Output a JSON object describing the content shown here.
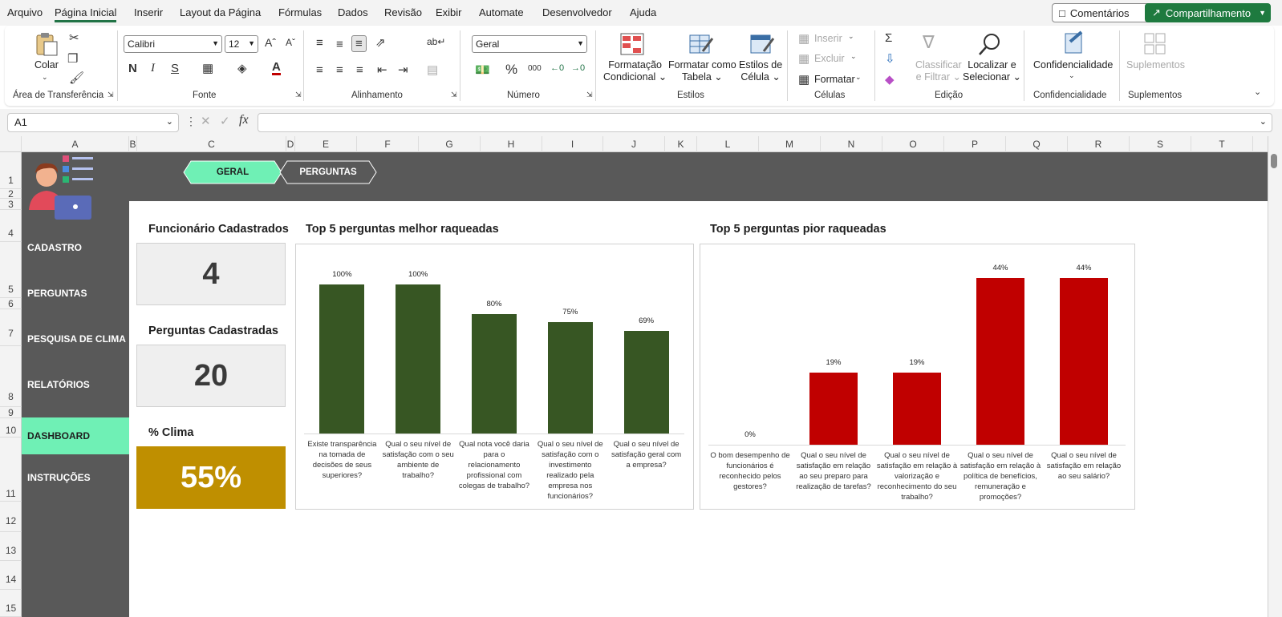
{
  "menu": {
    "items": [
      "Arquivo",
      "Página Inicial",
      "Inserir",
      "Layout da Página",
      "Fórmulas",
      "Dados",
      "Revisão",
      "Exibir",
      "Automate",
      "Desenvolvedor",
      "Ajuda"
    ],
    "active": "Página Inicial",
    "comments": "Comentários",
    "share": "Compartilhamento"
  },
  "ribbon": {
    "clipboard": {
      "paste": "Colar",
      "label": "Área de Transferência"
    },
    "font": {
      "name": "Calibri",
      "size": "12",
      "label": "Fonte"
    },
    "alignment": {
      "label": "Alinhamento"
    },
    "number": {
      "format": "Geral",
      "label": "Número"
    },
    "styles": {
      "conditional": [
        "Formatação",
        "Condicional"
      ],
      "table": [
        "Formatar como",
        "Tabela"
      ],
      "cell": [
        "Estilos de",
        "Célula"
      ],
      "label": "Estilos"
    },
    "cells": {
      "insert": "Inserir",
      "delete": "Excluir",
      "format": "Formatar",
      "label": "Células"
    },
    "editing": {
      "sort": [
        "Classificar",
        "e Filtrar"
      ],
      "find": [
        "Localizar e",
        "Selecionar"
      ],
      "label": "Edição"
    },
    "sensitivity": {
      "button": "Confidencialidade",
      "label": "Confidencialidade"
    },
    "addins": {
      "button": "Suplementos",
      "label": "Suplementos"
    }
  },
  "formula_bar": {
    "cell": "A1",
    "fx": "fx",
    "value": ""
  },
  "columns": [
    "A",
    "B",
    "C",
    "D",
    "E",
    "F",
    "G",
    "H",
    "I",
    "J",
    "K",
    "L",
    "M",
    "N",
    "O",
    "P",
    "Q",
    "R",
    "S",
    "T"
  ],
  "rows": [
    "1",
    "2",
    "3",
    "4",
    "5",
    "6",
    "7",
    "8",
    "9",
    "10",
    "11",
    "12",
    "13",
    "14",
    "15"
  ],
  "nav_tabs": {
    "geral": "GERAL",
    "perguntas": "PERGUNTAS"
  },
  "sidebar": {
    "items": [
      "CADASTRO",
      "PERGUNTAS",
      "PESQUISA DE CLIMA",
      "RELATÓRIOS",
      "DASHBOARD",
      "INSTRUÇÕES"
    ],
    "active": "DASHBOARD"
  },
  "kpis": {
    "funcionarios": {
      "title": "Funcionário Cadastrados",
      "value": "4"
    },
    "perguntas": {
      "title": "Perguntas Cadastradas",
      "value": "20"
    },
    "clima": {
      "title": "% Clima",
      "value": "55%"
    }
  },
  "colors": {
    "good_bar": "#375623",
    "bad_bar": "#c00000",
    "active_nav": "#6ff0b5",
    "clima_box": "#bf8f00",
    "band": "#595959"
  },
  "chart_data": [
    {
      "type": "bar",
      "title": "Top 5 perguntas melhor raqueadas",
      "categories": [
        "Existe transparência na tomada de decisões de seus superiores?",
        "Qual o seu nível de satisfação com o seu ambiente de trabalho?",
        "Qual nota você daria para o relacionamento profissional com colegas de trabalho?",
        "Qual o seu nível de satisfação com o investimento realizado pela empresa nos funcionários?",
        "Qual o seu nível de satisfação geral com a empresa?"
      ],
      "values": [
        100,
        100,
        80,
        75,
        69
      ],
      "labels": [
        "100%",
        "100%",
        "80%",
        "75%",
        "69%"
      ],
      "ylim": [
        0,
        100
      ],
      "grid": false,
      "color": "#375623"
    },
    {
      "type": "bar",
      "title": "Top 5 perguntas pior raqueadas",
      "categories": [
        "O bom desempenho de funcionários é reconhecido pelos gestores?",
        "Qual o seu nível de satisfação em relação ao seu preparo para realização de tarefas?",
        "Qual o seu nível de satisfação em relação à valorização e reconhecimento do seu trabalho?",
        "Qual o seu nível de satisfação em relação à política de benefícios, remuneração e promoções?",
        "Qual o seu nível de satisfação em relação ao seu salário?"
      ],
      "values": [
        0,
        19,
        19,
        44,
        44
      ],
      "labels": [
        "0%",
        "19%",
        "19%",
        "44%",
        "44%"
      ],
      "ylim": [
        0,
        44
      ],
      "grid": false,
      "color": "#c00000"
    }
  ]
}
